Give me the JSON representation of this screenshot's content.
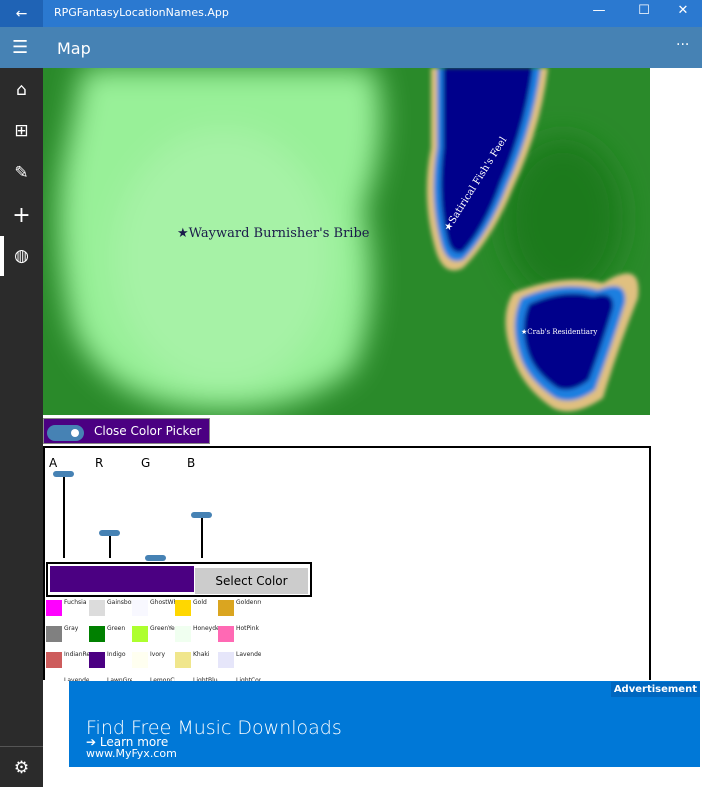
{
  "window": {
    "title": "RPGFantasyLocationNames.App",
    "back_icon": "arrow-left-icon",
    "minimize": "—",
    "maximize": "☐",
    "close": "✕"
  },
  "header": {
    "title": "Map",
    "menu_icon": "hamburger-icon",
    "more": "···"
  },
  "sidebar": {
    "items": [
      {
        "icon": "home-icon",
        "glyph": "⌂"
      },
      {
        "icon": "grid-icon",
        "glyph": "⊞"
      },
      {
        "icon": "pencil-icon",
        "glyph": "✎"
      },
      {
        "icon": "plus-icon",
        "glyph": "+"
      },
      {
        "icon": "globe-icon",
        "glyph": "◍"
      }
    ],
    "settings": {
      "icon": "gear-icon",
      "glyph": "⚙"
    }
  },
  "map": {
    "labels": [
      "★Wayward Burnisher's Bribe",
      "★Satirical Fish's Feel",
      "★Crab's Residentiary"
    ]
  },
  "picker": {
    "toggle_label": "Close Color Picker",
    "toggle_on": true,
    "channels": [
      {
        "name": "A",
        "value": 255
      },
      {
        "name": "R",
        "value": 75
      },
      {
        "name": "G",
        "value": 0
      },
      {
        "name": "B",
        "value": 130
      }
    ],
    "selected_color": "#4b0082",
    "select_label": "Select Color",
    "swatches": [
      {
        "name": "Fuchsia",
        "color": "#ff00ff"
      },
      {
        "name": "Gainsboro",
        "color": "#dcdcdc"
      },
      {
        "name": "GhostWhite",
        "color": "#f8f8ff"
      },
      {
        "name": "Gold",
        "color": "#ffd700"
      },
      {
        "name": "Goldenrod",
        "color": "#daa520"
      },
      {
        "name": "Gray",
        "color": "#808080"
      },
      {
        "name": "Green",
        "color": "#008000"
      },
      {
        "name": "GreenYellow",
        "color": "#adff2f"
      },
      {
        "name": "Honeydew",
        "color": "#f0fff0"
      },
      {
        "name": "HotPink",
        "color": "#ff69b4"
      },
      {
        "name": "IndianRed",
        "color": "#cd5c5c"
      },
      {
        "name": "Indigo",
        "color": "#4b0082"
      },
      {
        "name": "Ivory",
        "color": "#fffff0"
      },
      {
        "name": "Khaki",
        "color": "#f0e68c"
      },
      {
        "name": "Lavender",
        "color": "#e6e6fa"
      },
      {
        "name": "LavenderBlush",
        "color": "#fff0f5"
      },
      {
        "name": "LawnGreen",
        "color": "#7cfc00"
      },
      {
        "name": "LemonChiffon",
        "color": "#fffacd"
      },
      {
        "name": "LightBlue",
        "color": "#add8e6"
      },
      {
        "name": "LightCoral",
        "color": "#f08080"
      }
    ]
  },
  "ad": {
    "tag": "Advertisement",
    "headline": "Find Free Music Downloads",
    "cta": "Learn more",
    "url": "www.MyFyx.com"
  }
}
